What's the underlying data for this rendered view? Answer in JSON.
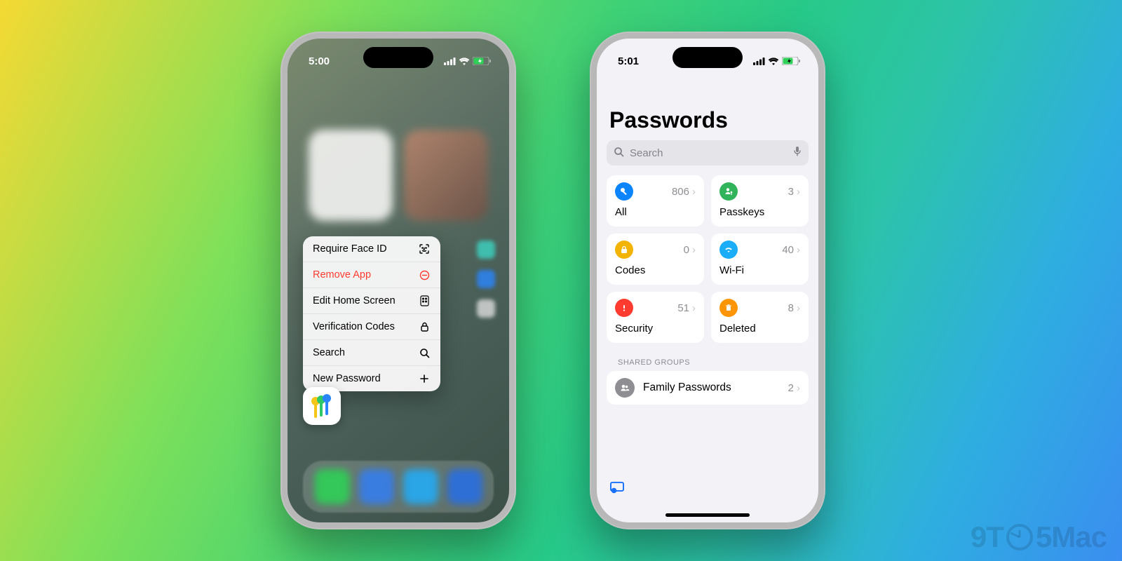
{
  "watermark": {
    "prefix": "9T",
    "suffix": "5Mac"
  },
  "left_phone": {
    "time": "5:00",
    "menu": [
      {
        "label": "Require Face ID",
        "icon": "faceid"
      },
      {
        "label": "Remove App",
        "icon": "remove",
        "danger": true
      },
      {
        "label": "Edit Home Screen",
        "icon": "apps"
      },
      {
        "label": "Verification Codes",
        "icon": "lock"
      },
      {
        "label": "Search",
        "icon": "search"
      },
      {
        "label": "New Password",
        "icon": "plus"
      }
    ]
  },
  "right_phone": {
    "time": "5:01",
    "title": "Passwords",
    "search_placeholder": "Search",
    "cards": {
      "all": {
        "label": "All",
        "count": "806",
        "color": "#0a84ff",
        "icon": "key"
      },
      "passkeys": {
        "label": "Passkeys",
        "count": "3",
        "color": "#30b35a",
        "icon": "person"
      },
      "codes": {
        "label": "Codes",
        "count": "0",
        "color": "#f2b400",
        "icon": "lockclock"
      },
      "wifi": {
        "label": "Wi-Fi",
        "count": "40",
        "color": "#1badf8",
        "icon": "wifi"
      },
      "security": {
        "label": "Security",
        "count": "51",
        "color": "#ff3b30",
        "icon": "exclaim"
      },
      "deleted": {
        "label": "Deleted",
        "count": "8",
        "color": "#ff9500",
        "icon": "trash"
      }
    },
    "shared_groups_header": "SHARED GROUPS",
    "shared_groups": [
      {
        "label": "Family Passwords",
        "count": "2"
      }
    ]
  }
}
